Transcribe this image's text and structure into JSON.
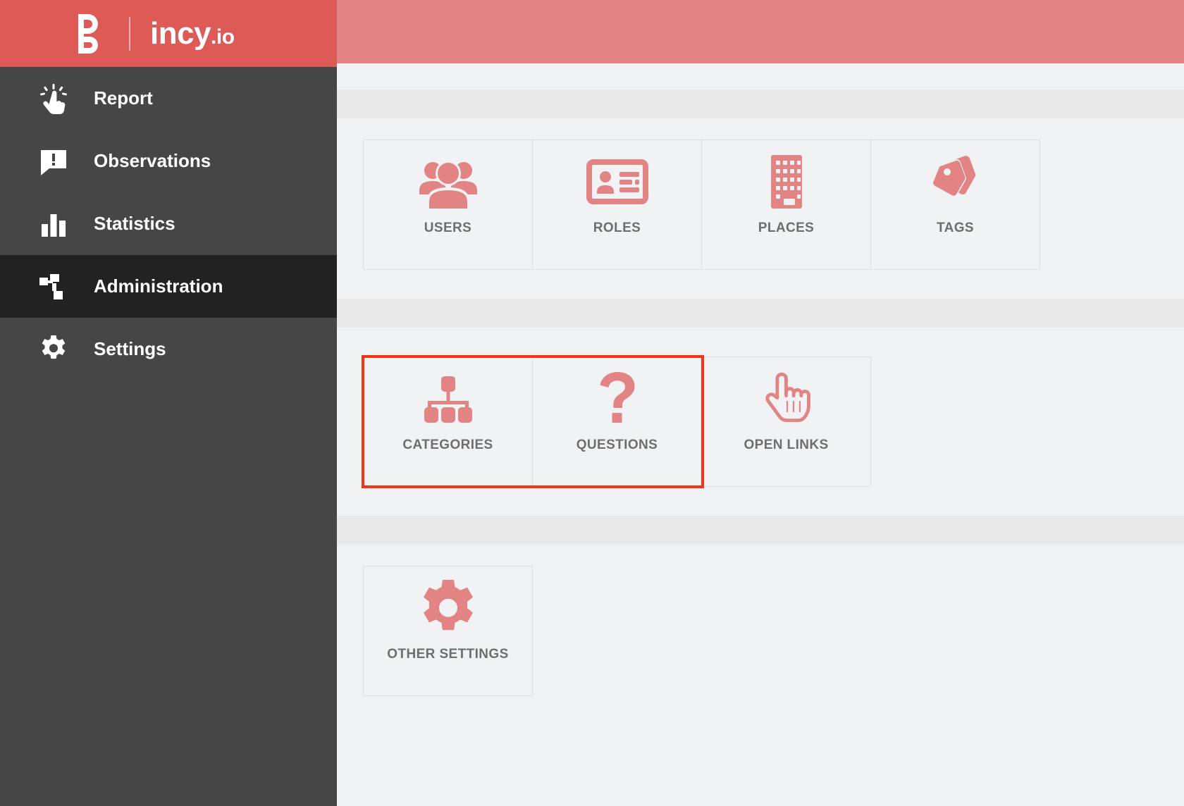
{
  "brand": {
    "logo_icon": "incy-b-logo-icon",
    "name": "incy",
    "tld": ".io"
  },
  "colors": {
    "brand_red": "#dd5a57",
    "topbar_pink": "#e28483",
    "sidebar_dark": "#464646",
    "sidebar_active": "#222222",
    "icon_pink": "#e28483",
    "highlight_red": "#f23418",
    "label_grey": "#6e6e6e",
    "panel_bg": "#f1f2f4",
    "band_grey": "#e9e9e9"
  },
  "sidebar": {
    "items": [
      {
        "label": "Report",
        "icon": "click-hand-icon",
        "active": false
      },
      {
        "label": "Observations",
        "icon": "speech-alert-icon",
        "active": false
      },
      {
        "label": "Statistics",
        "icon": "bar-chart-icon",
        "active": false
      },
      {
        "label": "Administration",
        "icon": "sitemap-icon",
        "active": true
      },
      {
        "label": "Settings",
        "icon": "gear-icon",
        "active": false
      }
    ]
  },
  "main": {
    "sections": [
      {
        "title": "",
        "tiles": [
          {
            "label": "USERS",
            "icon": "users-group-icon",
            "highlighted": false
          },
          {
            "label": "ROLES",
            "icon": "id-card-icon",
            "highlighted": false
          },
          {
            "label": "PLACES",
            "icon": "building-icon",
            "highlighted": false
          },
          {
            "label": "TAGS",
            "icon": "tags-icon",
            "highlighted": false
          }
        ]
      },
      {
        "title": "",
        "tiles": [
          {
            "label": "CATEGORIES",
            "icon": "hierarchy-icon",
            "highlighted": true
          },
          {
            "label": "QUESTIONS",
            "icon": "question-mark-icon",
            "highlighted": true
          },
          {
            "label": "OPEN LINKS",
            "icon": "pointing-hand-icon",
            "highlighted": false
          }
        ]
      },
      {
        "title": "",
        "tiles": [
          {
            "label": "OTHER SETTINGS",
            "icon": "gear-icon",
            "highlighted": false
          }
        ]
      }
    ]
  }
}
